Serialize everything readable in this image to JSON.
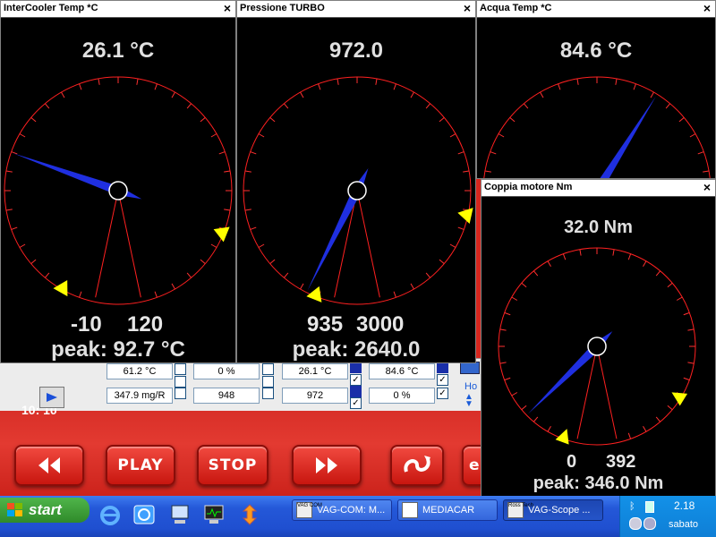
{
  "gauges": [
    {
      "title": "InterCooler Temp *C",
      "value": "26.1 °C",
      "range_min": "-10",
      "range_max": "120",
      "peak": "peak: 92.7 °C",
      "needle_fraction": 0.28,
      "marker1_fraction": 0.03,
      "marker2_fraction": 0.85
    },
    {
      "title": "Pressione TURBO",
      "value": "972.0",
      "range_min": "935",
      "range_max": "3000",
      "peak": "peak: 2640.0",
      "needle_fraction": 0.02,
      "marker1_fraction": 0.005,
      "marker2_fraction": 0.82
    },
    {
      "title": "Acqua Temp *C",
      "value": "84.6 °C",
      "needle_fraction": 0.6
    },
    {
      "title": "Coppia motore Nm",
      "value": "32.0 Nm",
      "range_min": "0",
      "range_max": "392",
      "peak": "peak: 346.0 Nm",
      "needle_fraction": 0.08,
      "marker1_fraction": 0.0,
      "marker2_fraction": 0.88
    }
  ],
  "data_strip": {
    "row1": [
      "61.2 °C",
      "0 %",
      "26.1 °C",
      "84.6 °C"
    ],
    "row2": [
      "347.9 mg/R",
      "948",
      "972",
      "0 %"
    ],
    "partial_label": "Ho",
    "behind_text": "10: 10"
  },
  "controls": {
    "rewind": "◀◀",
    "play": "PLAY",
    "stop": "STOP",
    "forward": "▶▶",
    "last": "e"
  },
  "taskbar": {
    "start": "start",
    "buttons": [
      {
        "label": "VAG-COM: M...",
        "icon": "VAG COM"
      },
      {
        "label": "MEDIACAR",
        "icon": ""
      },
      {
        "label": "VAG-Scope ...",
        "icon": "Ross Tech"
      }
    ],
    "clock": "2.18",
    "day": "sabato"
  },
  "colors": {
    "needle": "#1f2fe0",
    "marker": "#ffff00",
    "dial": "#ff2020",
    "tick": "#ff3030"
  }
}
